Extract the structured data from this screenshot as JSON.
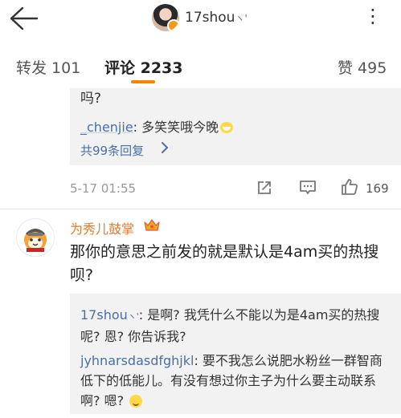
{
  "header": {
    "title": "17shou",
    "verified_marks": "ヽ'",
    "back_icon": "back-arrow-icon",
    "more_icon": "more-dots-icon",
    "more_text": "⋮"
  },
  "tabs": {
    "repost": "转发 101",
    "comment": "评论 2233",
    "like": "赞 495",
    "active": "comment",
    "accent_color": "#ff8200"
  },
  "reply_block_1": {
    "line1": "吗?",
    "user": "_chenjie",
    "sep": ":",
    "text": " 多笑笑哦今晚",
    "more_replies": "共99条回复",
    "chevron_icon": "chevron-right-icon"
  },
  "meta": {
    "date": "5-17 01:55",
    "likes": "169"
  },
  "comment2": {
    "author": "为秀儿鼓掌",
    "text": "那你的意思之前发的就是默认是4am买的热搜呗?",
    "author_color": "#e07b2e",
    "replies": [
      {
        "user": "17shou",
        "verified": "ヽ'",
        "sep": ":",
        "text": " 是啊? 我凭什么不能以为是4am买的热搜呢? 恩? 你告诉我?"
      },
      {
        "user": "jyhnarsdasdfghjkl",
        "sep": ":",
        "text": " 要不我怎么说肥水粉丝一群智商低下的低能儿。有没有想过你主子为什么要主动联系啊? 嗯? "
      }
    ]
  },
  "colors": {
    "link_blue": "#4a6fa5",
    "reply_bg": "#f2f2f2"
  }
}
